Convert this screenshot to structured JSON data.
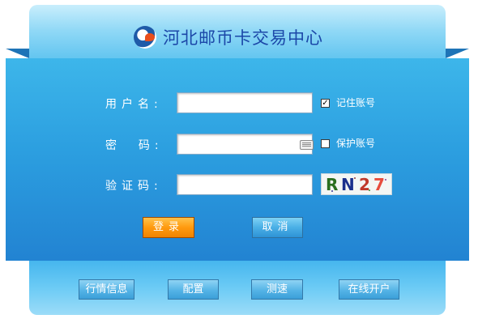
{
  "header": {
    "title": "河北邮币卡交易中心",
    "logo_icon": "exchange-logo-icon"
  },
  "form": {
    "username_label": "用户名:",
    "username_value": "",
    "password_label": "密  码:",
    "password_value": "",
    "captcha_label": "验证码:",
    "captcha_value": "",
    "captcha_text": [
      "R",
      "N",
      "2",
      "7"
    ],
    "remember_account_label": "记住账号",
    "remember_account_checked": true,
    "protect_account_label": "保护账号",
    "protect_account_checked": false,
    "keyboard_icon": "soft-keyboard-icon"
  },
  "actions": {
    "login_label": "登录",
    "cancel_label": "取消"
  },
  "footer": {
    "buttons": [
      "行情信息",
      "配置",
      "测速",
      "在线开户"
    ]
  },
  "colors": {
    "title": "#1b47a8",
    "panel_blue": "#2c9fe0",
    "login_orange": "#ff9a0f"
  }
}
